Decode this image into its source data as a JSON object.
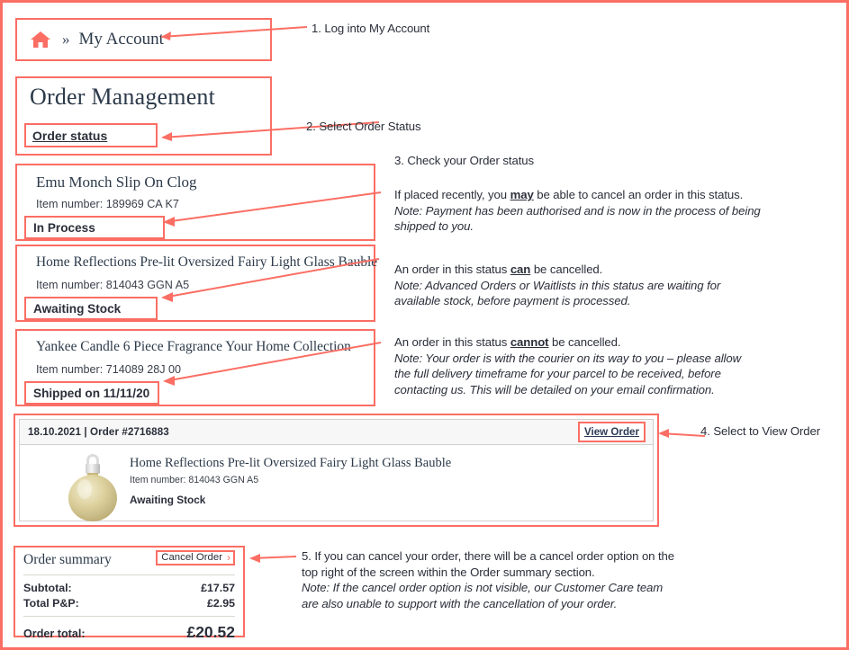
{
  "breadcrumb": {
    "home_icon": "home-icon",
    "separator": "»",
    "label": "My Account"
  },
  "order_management": {
    "title": "Order Management",
    "status_tab_label": "Order status"
  },
  "status_examples": [
    {
      "product": "Emu Monch Slip On Clog",
      "item_number": "Item number: 189969 CA K7",
      "status": "In Process"
    },
    {
      "product": "Home Reflections Pre-lit Oversized Fairy Light Glass Bauble",
      "item_number": "Item number: 814043 GGN A5",
      "status": "Awaiting Stock"
    },
    {
      "product": "Yankee Candle 6 Piece Fragrance Your Home Collection",
      "item_number": "Item number: 714089 28J 00",
      "status": "Shipped on 11/11/20"
    }
  ],
  "order_card": {
    "meta": "18.10.2021 | Order #2716883",
    "view_order_label": "View Order",
    "product": "Home Reflections Pre-lit Oversized Fairy Light Glass Bauble",
    "item_number": "Item number: 814043 GGN A5",
    "status": "Awaiting Stock",
    "thumbnail_icon": "christmas-bauble-icon"
  },
  "order_summary": {
    "title": "Order summary",
    "cancel_label": "Cancel Order",
    "cancel_chevron": "›",
    "rows": [
      {
        "label": "Subtotal:",
        "value": "£17.57"
      },
      {
        "label": "Total P&P:",
        "value": "£2.95"
      }
    ],
    "total_label": "Order total:",
    "total_value": "£20.52"
  },
  "annotations": {
    "step1": "1. Log into My Account",
    "step2": "2. Select Order Status",
    "step3": "3. Check your Order status",
    "step4": "4. Select to View Order",
    "in_process": {
      "line1_a": "If placed recently, you ",
      "line1_em": "may",
      "line1_b": " be able to cancel an order in this status.",
      "note": "Note: Payment has been authorised and is now in the process of being shipped to you."
    },
    "awaiting_stock": {
      "line1_a": "An order in this status ",
      "line1_em": "can",
      "line1_b": " be cancelled.",
      "note": "Note: Advanced Orders or Waitlists in this status are waiting for available stock, before payment is processed."
    },
    "shipped": {
      "line1_a": "An order in this status ",
      "line1_em": "cannot",
      "line1_b": " be cancelled.",
      "note": "Note: Your order is with the courier on its way to you – please allow the full delivery timeframe for your parcel to be received, before contacting us. This will be detailed on your email confirmation."
    },
    "step5": {
      "line1": "5. If you can cancel your order, there will be a cancel order option on the top right of the screen within the Order summary section.",
      "note": "Note: If the cancel order option is not visible, our Customer Care team are also unable to support with the cancellation of your order."
    }
  },
  "colors": {
    "accent": "#fb6e64",
    "text": "#2b2f3a",
    "heading": "#2c3a4a",
    "bauble_gold": "#d8cf9a"
  }
}
